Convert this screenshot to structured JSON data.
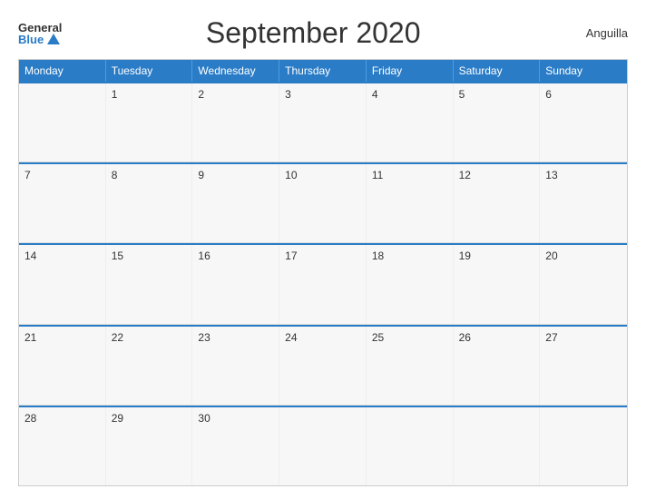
{
  "logo": {
    "general": "General",
    "blue": "Blue"
  },
  "title": "September 2020",
  "country": "Anguilla",
  "days_header": [
    "Monday",
    "Tuesday",
    "Wednesday",
    "Thursday",
    "Friday",
    "Saturday",
    "Sunday"
  ],
  "weeks": [
    [
      {
        "num": "",
        "empty": true
      },
      {
        "num": "1",
        "empty": false
      },
      {
        "num": "2",
        "empty": false
      },
      {
        "num": "3",
        "empty": false
      },
      {
        "num": "4",
        "empty": false
      },
      {
        "num": "5",
        "empty": false
      },
      {
        "num": "6",
        "empty": false
      }
    ],
    [
      {
        "num": "7",
        "empty": false
      },
      {
        "num": "8",
        "empty": false
      },
      {
        "num": "9",
        "empty": false
      },
      {
        "num": "10",
        "empty": false
      },
      {
        "num": "11",
        "empty": false
      },
      {
        "num": "12",
        "empty": false
      },
      {
        "num": "13",
        "empty": false
      }
    ],
    [
      {
        "num": "14",
        "empty": false
      },
      {
        "num": "15",
        "empty": false
      },
      {
        "num": "16",
        "empty": false
      },
      {
        "num": "17",
        "empty": false
      },
      {
        "num": "18",
        "empty": false
      },
      {
        "num": "19",
        "empty": false
      },
      {
        "num": "20",
        "empty": false
      }
    ],
    [
      {
        "num": "21",
        "empty": false
      },
      {
        "num": "22",
        "empty": false
      },
      {
        "num": "23",
        "empty": false
      },
      {
        "num": "24",
        "empty": false
      },
      {
        "num": "25",
        "empty": false
      },
      {
        "num": "26",
        "empty": false
      },
      {
        "num": "27",
        "empty": false
      }
    ],
    [
      {
        "num": "28",
        "empty": false
      },
      {
        "num": "29",
        "empty": false
      },
      {
        "num": "30",
        "empty": false
      },
      {
        "num": "",
        "empty": true
      },
      {
        "num": "",
        "empty": true
      },
      {
        "num": "",
        "empty": true
      },
      {
        "num": "",
        "empty": true
      }
    ]
  ]
}
